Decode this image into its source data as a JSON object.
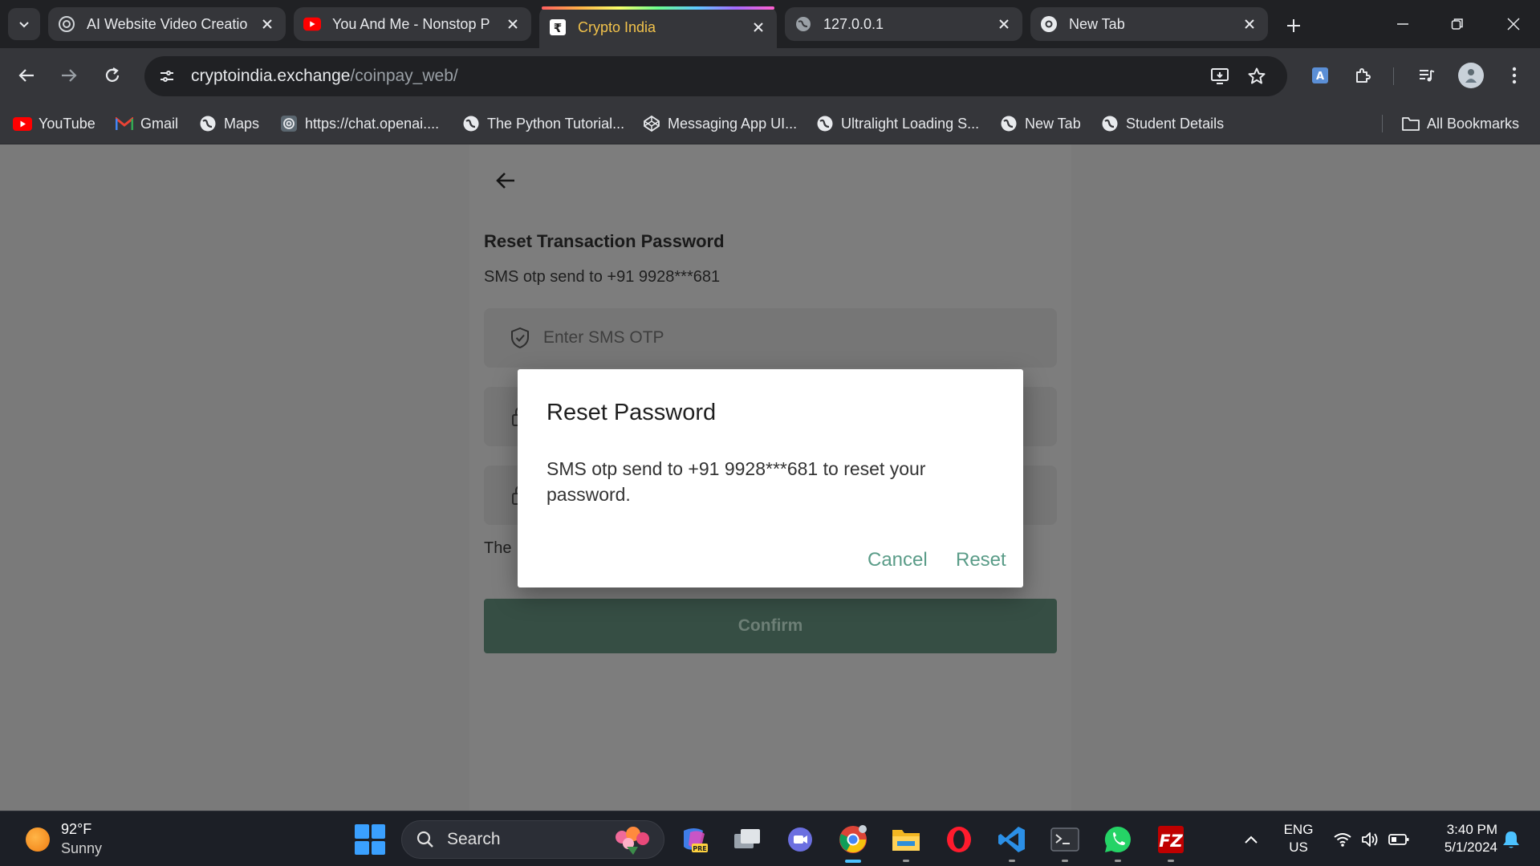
{
  "browser": {
    "tabs": [
      {
        "title": "AI Website Video Creatio",
        "favicon": "chatgpt-icon",
        "active": false
      },
      {
        "title": "You And Me - Nonstop P",
        "favicon": "youtube-icon",
        "active": false
      },
      {
        "title": "Crypto India",
        "favicon": "rupee-icon",
        "active": true
      },
      {
        "title": "127.0.0.1",
        "favicon": "globe-icon",
        "active": false
      },
      {
        "title": "New Tab",
        "favicon": "chrome-icon",
        "active": false
      }
    ],
    "url_host": "cryptoindia.exchange",
    "url_path": "/coinpay_web/",
    "bookmarks": [
      {
        "label": "YouTube",
        "icon": "youtube-icon"
      },
      {
        "label": "Gmail",
        "icon": "gmail-icon"
      },
      {
        "label": "Maps",
        "icon": "globe-icon"
      },
      {
        "label": "https://chat.openai....",
        "icon": "chatgpt-icon"
      },
      {
        "label": "The Python Tutorial...",
        "icon": "globe-icon"
      },
      {
        "label": "Messaging App UI...",
        "icon": "codepen-icon"
      },
      {
        "label": "Ultralight Loading S...",
        "icon": "globe-icon"
      },
      {
        "label": "New Tab",
        "icon": "globe-icon"
      },
      {
        "label": "Student Details",
        "icon": "globe-icon"
      }
    ],
    "all_bookmarks": "All Bookmarks"
  },
  "page": {
    "title": "Reset Transaction Password",
    "subtitle": "SMS otp send to +91 9928***681",
    "otp_placeholder": "Enter SMS OTP",
    "note_visible": "The",
    "confirm_label": "Confirm"
  },
  "dialog": {
    "title": "Reset Password",
    "body": "SMS otp send to +91 9928***681 to reset your password.",
    "cancel_label": "Cancel",
    "reset_label": "Reset"
  },
  "taskbar": {
    "temperature": "92°F",
    "condition": "Sunny",
    "search_label": "Search",
    "lang_top": "ENG",
    "lang_bottom": "US",
    "time": "3:40 PM",
    "date": "5/1/2024"
  },
  "colors": {
    "accent_tab": "#f1c24b",
    "dialog_button": "#5a9c88",
    "confirm_bg": "#364e44"
  }
}
